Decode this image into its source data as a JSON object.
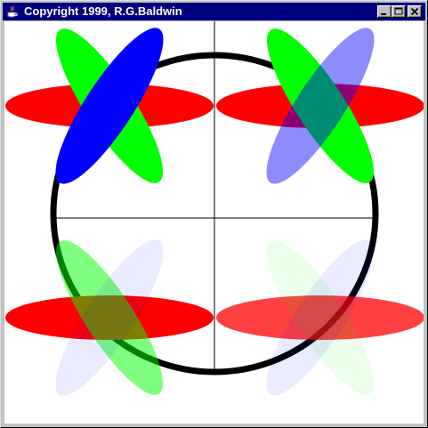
{
  "window": {
    "title": "Copyright 1999, R.G.Baldwin",
    "controls": {
      "minimize_icon": "minimize-icon",
      "maximize_icon": "maximize-icon",
      "close_icon": "close-icon"
    },
    "title_bar_color": "#000080"
  },
  "canvas": {
    "background": "#ffffff",
    "guide_line_color": "#000000",
    "circle_color": "#000000",
    "ellipse_colors": {
      "red": "#ff0000",
      "green": "#00ff00",
      "blue": "#0000ff"
    },
    "quadrants": [
      {
        "name": "top-left",
        "red_opacity": 1.0,
        "green_opacity": 1.0,
        "blue_opacity": 1.0
      },
      {
        "name": "top-right",
        "red_opacity": 1.0,
        "green_opacity": 1.0,
        "blue_opacity": 0.45
      },
      {
        "name": "bottom-left",
        "red_opacity": 1.0,
        "green_opacity": 0.5,
        "blue_opacity": 0.08
      },
      {
        "name": "bottom-right",
        "red_opacity": 0.75,
        "green_opacity": 0.08,
        "blue_opacity": 0.08
      }
    ]
  }
}
